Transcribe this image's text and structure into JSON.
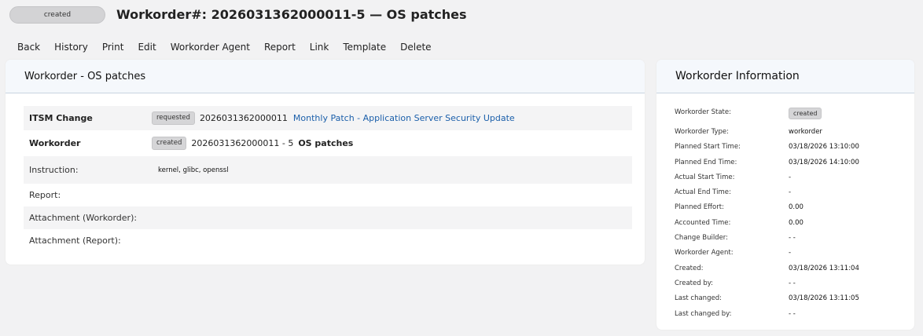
{
  "header": {
    "state": "created",
    "title": "Workorder#: 2026031362000011-5 — OS patches"
  },
  "menu": [
    "Back",
    "History",
    "Print",
    "Edit",
    "Workorder Agent",
    "Report",
    "Link",
    "Template",
    "Delete"
  ],
  "main_panel": {
    "title": "Workorder - OS patches",
    "itsm_change": {
      "label": "ITSM Change",
      "state": "requested",
      "number": "2026031362000011",
      "link_text": "Monthly Patch - Application Server Security Update"
    },
    "workorder": {
      "label": "Workorder",
      "state": "created",
      "number": "2026031362000011 - 5",
      "title": "OS patches"
    },
    "instruction": {
      "label": "Instruction:",
      "value": "kernel, glibc, openssl"
    },
    "report": {
      "label": "Report:"
    },
    "attachment_workorder": {
      "label": "Attachment (Workorder):"
    },
    "attachment_report": {
      "label": "Attachment (Report):"
    }
  },
  "info_panel": {
    "title": "Workorder Information",
    "state_label": "Workorder State:",
    "state_value": "created",
    "rows": [
      {
        "key": "Workorder Type:",
        "value": "workorder"
      },
      {
        "key": "Planned Start Time:",
        "value": "03/18/2026 13:10:00"
      },
      {
        "key": "Planned End Time:",
        "value": "03/18/2026 14:10:00"
      },
      {
        "key": "Actual Start Time:",
        "value": "-"
      },
      {
        "key": "Actual End Time:",
        "value": "-"
      },
      {
        "key": "Planned Effort:",
        "value": "0.00"
      },
      {
        "key": "Accounted Time:",
        "value": "0.00"
      },
      {
        "key": "Change Builder:",
        "value": "- -"
      },
      {
        "key": "Workorder Agent:",
        "value": "-"
      },
      {
        "key": "Created:",
        "value": "03/18/2026 13:11:04"
      },
      {
        "key": "Created by:",
        "value": "- -"
      },
      {
        "key": "Last changed:",
        "value": "03/18/2026 13:11:05"
      },
      {
        "key": "Last changed by:",
        "value": "- -"
      }
    ]
  }
}
